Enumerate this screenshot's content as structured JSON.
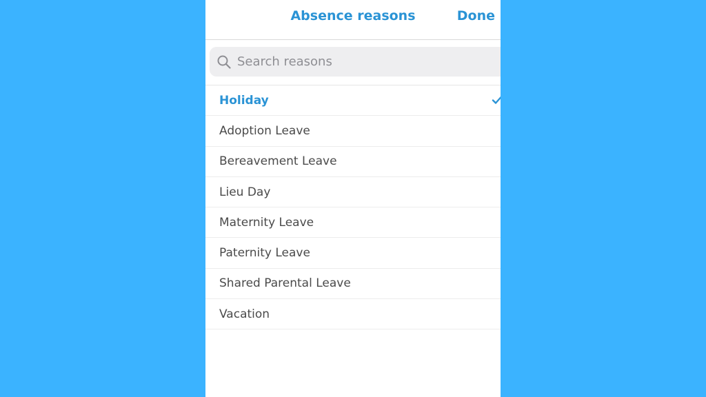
{
  "header": {
    "title": "Absence reasons",
    "done_label": "Done"
  },
  "search": {
    "placeholder": "Search reasons",
    "value": ""
  },
  "reasons": {
    "selected_index": 0,
    "items": [
      {
        "label": "Holiday"
      },
      {
        "label": "Adoption Leave"
      },
      {
        "label": "Bereavement Leave"
      },
      {
        "label": "Lieu Day"
      },
      {
        "label": "Maternity Leave"
      },
      {
        "label": "Paternity Leave"
      },
      {
        "label": "Shared Parental Leave"
      },
      {
        "label": "Vacation"
      }
    ]
  },
  "icons": {
    "search": "search-icon",
    "check": "checkmark-icon"
  },
  "colors": {
    "background": "#3BB3FF",
    "accent": "#2A93D5",
    "text": "#4a4a4a"
  }
}
